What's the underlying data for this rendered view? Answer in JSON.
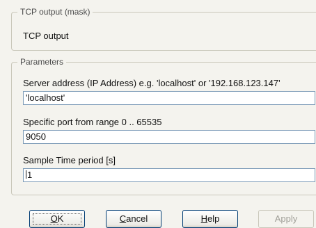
{
  "mask_group": {
    "legend": "TCP output (mask)",
    "description": "TCP output"
  },
  "params_group": {
    "legend": "Parameters",
    "fields": [
      {
        "label": "Server address (IP Address) e.g. 'localhost' or '192.168.123.147'",
        "value": "'localhost'"
      },
      {
        "label": "Specific port from range 0 .. 65535",
        "value": "9050"
      },
      {
        "label": "Sample Time period [s]",
        "value": "1"
      }
    ]
  },
  "buttons": {
    "ok": {
      "accel": "O",
      "rest": "K"
    },
    "cancel": {
      "accel": "C",
      "rest": "ancel"
    },
    "help": {
      "accel": "H",
      "rest": "elp"
    },
    "apply": {
      "label": "Apply",
      "enabled": false
    }
  }
}
